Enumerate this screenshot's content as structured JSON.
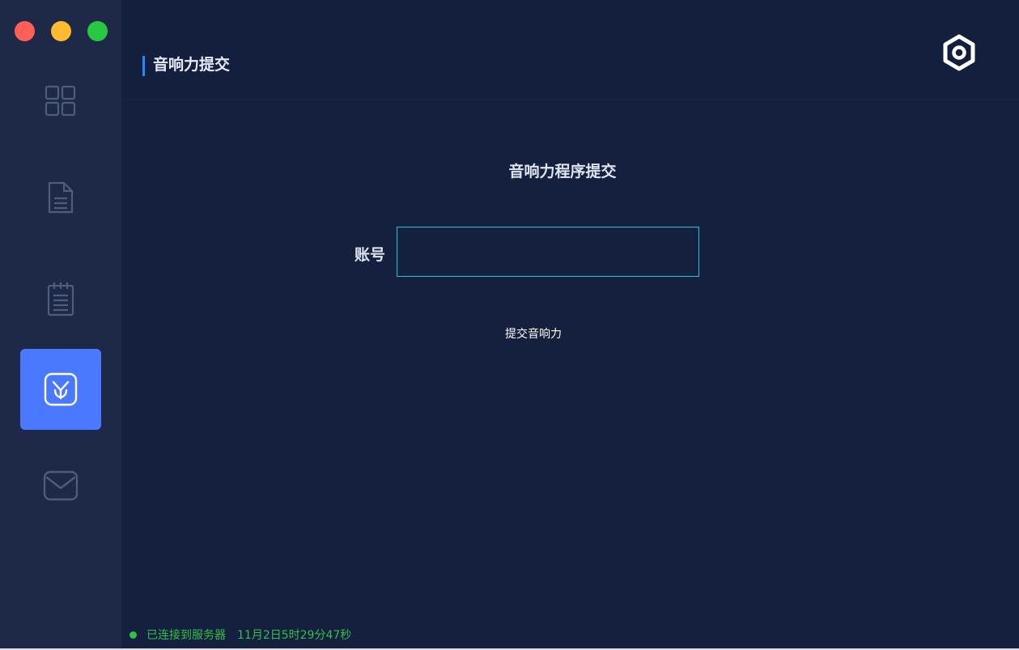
{
  "window": {
    "controls": {
      "close_color": "#ff5f57",
      "minimize_color": "#febc2e",
      "maximize_color": "#28c840"
    }
  },
  "sidebar": {
    "items": [
      {
        "icon": "dashboard-grid-icon",
        "active": false
      },
      {
        "icon": "document-icon",
        "active": false
      },
      {
        "icon": "notepad-icon",
        "active": false
      },
      {
        "icon": "sprout-icon",
        "active": true
      },
      {
        "icon": "mail-icon",
        "active": false
      }
    ],
    "active_color": "#4a78ff"
  },
  "header": {
    "title": "音响力提交",
    "accent_color": "#1f8bff",
    "settings_icon": "hex-settings-icon"
  },
  "form": {
    "title": "音响力程序提交",
    "account_label": "账号",
    "account_value": "",
    "input_border_color": "#17c8d6",
    "submit_label": "提交音响力"
  },
  "status": {
    "connection_text": "已连接到服务器",
    "time_text": "11月2日5时29分47秒",
    "color": "#2ec24a"
  }
}
